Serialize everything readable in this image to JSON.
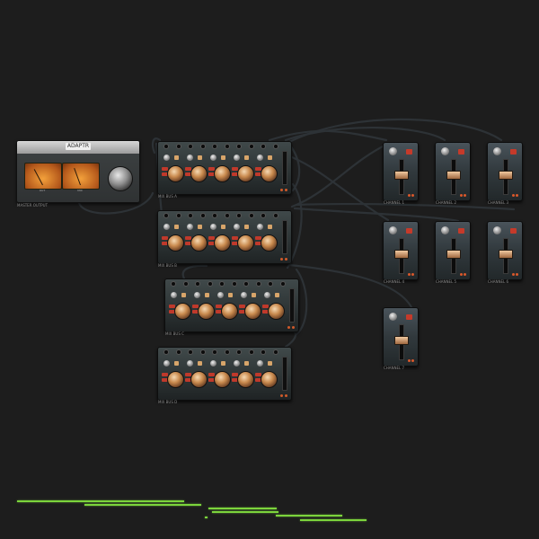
{
  "meter": {
    "cap_label": "ADAPTR",
    "left_label": "OUT",
    "right_label": "MIX",
    "foot": "MASTER OUTPUT"
  },
  "mixers": [
    {
      "foot": "MIX BUS A"
    },
    {
      "foot": "MIX BUS B"
    },
    {
      "foot": "MIX BUS C"
    },
    {
      "foot": "MIX BUS D"
    }
  ],
  "channels": [
    {
      "foot": "CHANNEL 1"
    },
    {
      "foot": "CHANNEL 2"
    },
    {
      "foot": "CHANNEL 3"
    },
    {
      "foot": "CHANNEL 4"
    },
    {
      "foot": "CHANNEL 5"
    },
    {
      "foot": "CHANNEL 6"
    },
    {
      "foot": "CHANNEL 7"
    }
  ],
  "colors": {
    "background": "#1d1d1d",
    "cable": "#2a2f33",
    "timeline_bar": "#7cd43c",
    "accent_red": "#c53a2a",
    "knob_copper": "#c98a4e"
  }
}
